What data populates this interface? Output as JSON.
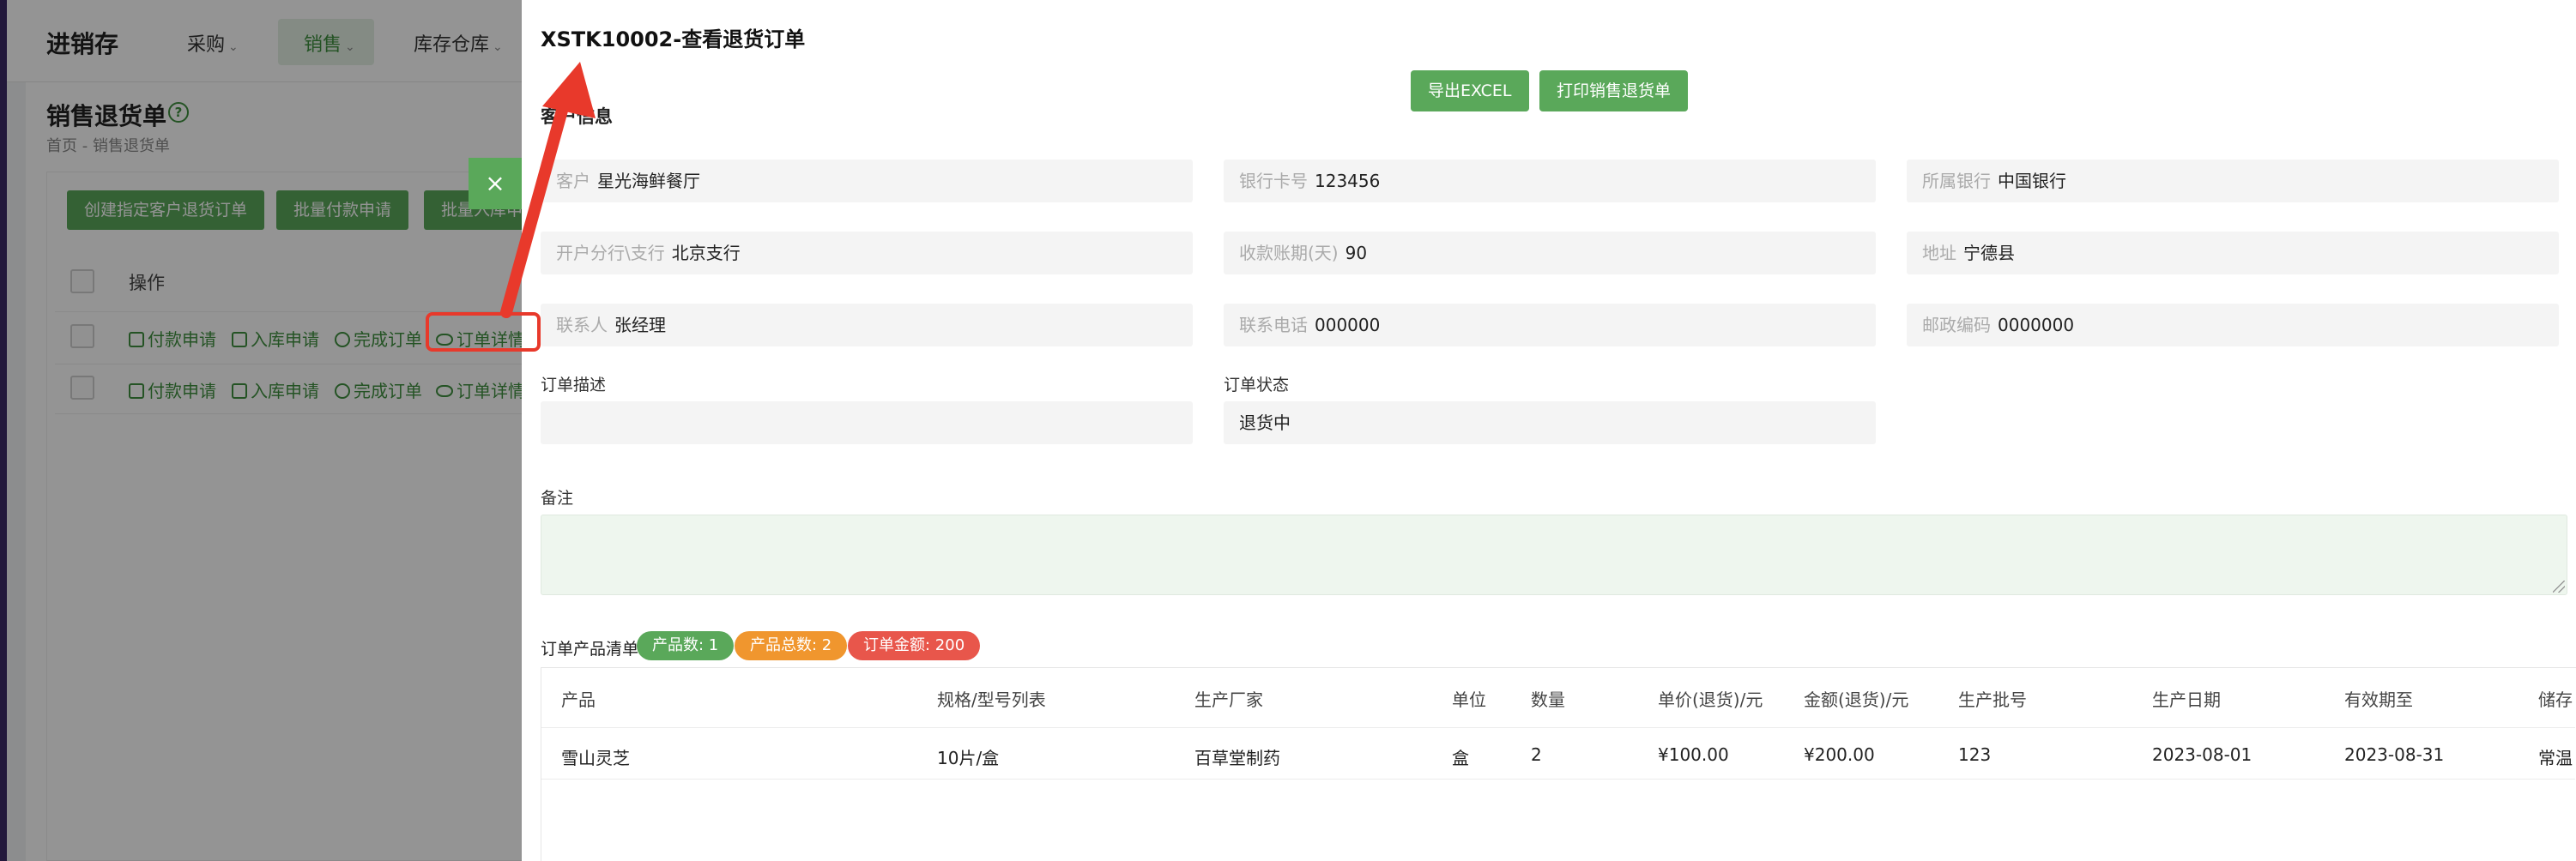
{
  "app": {
    "title": "进销存",
    "nav": [
      {
        "label": "采购",
        "active": false
      },
      {
        "label": "销售",
        "active": true
      },
      {
        "label": "库存仓库",
        "active": false
      }
    ],
    "chevron_icon": "chevron-down-icon"
  },
  "page": {
    "title": "销售退货单",
    "help_icon": "question-circle-icon",
    "breadcrumb": "首页 - 销售退货单",
    "buttons": [
      "创建指定客户退货订单",
      "批量付款申请",
      "批量入库申"
    ],
    "table_header": {
      "operation": "操作"
    },
    "rows": [
      {
        "actions": [
          "付款申请",
          "入库申请",
          "完成订单",
          "订单详情"
        ]
      },
      {
        "actions": [
          "付款申请",
          "入库申请",
          "完成订单",
          "订单详情"
        ]
      }
    ]
  },
  "close_button": {
    "label": "×"
  },
  "drawer": {
    "title": "XSTK10002-查看退货订单",
    "export_label": "导出EXCEL",
    "print_label": "打印销售退货单",
    "section_title": "客户信息",
    "fields": {
      "customer": {
        "label": "客户",
        "value": "星光海鲜餐厅"
      },
      "bank_card": {
        "label": "银行卡号",
        "value": "123456"
      },
      "bank": {
        "label": "所属银行",
        "value": "中国银行"
      },
      "branch": {
        "label": "开户分行\\支行",
        "value": "北京支行"
      },
      "payment_days": {
        "label": "收款账期(天)",
        "value": "90"
      },
      "address": {
        "label": "地址",
        "value": "宁德县"
      },
      "contact": {
        "label": "联系人",
        "value": "张经理"
      },
      "phone": {
        "label": "联系电话",
        "value": "000000"
      },
      "postcode": {
        "label": "邮政编码",
        "value": "0000000"
      }
    },
    "order_desc": {
      "label": "订单描述",
      "value": ""
    },
    "order_status": {
      "label": "订单状态",
      "value": "退货中"
    },
    "remark": {
      "label": "备注",
      "value": ""
    },
    "product_list": {
      "label": "订单产品清单",
      "badges": [
        {
          "label": "产品数: 1",
          "color": "#5aa85a"
        },
        {
          "label": "产品总数: 2",
          "color": "#f0962e"
        },
        {
          "label": "订单金额: 200",
          "color": "#e8564b"
        }
      ],
      "columns": [
        "产品",
        "规格/型号列表",
        "生产厂家",
        "单位",
        "数量",
        "单价(退货)/元",
        "金额(退货)/元",
        "生产批号",
        "生产日期",
        "有效期至",
        "储存"
      ],
      "rows": [
        [
          "雪山灵芝",
          "10片/盒",
          "百草堂制药",
          "盒",
          "2",
          "¥100.00",
          "¥200.00",
          "123",
          "2023-08-01",
          "2023-08-31",
          "常温"
        ]
      ]
    }
  },
  "colors": {
    "primary_green": "#5aa85a",
    "annotation_red": "#e8392b",
    "mask": "rgba(0,0,0,0.42)"
  }
}
